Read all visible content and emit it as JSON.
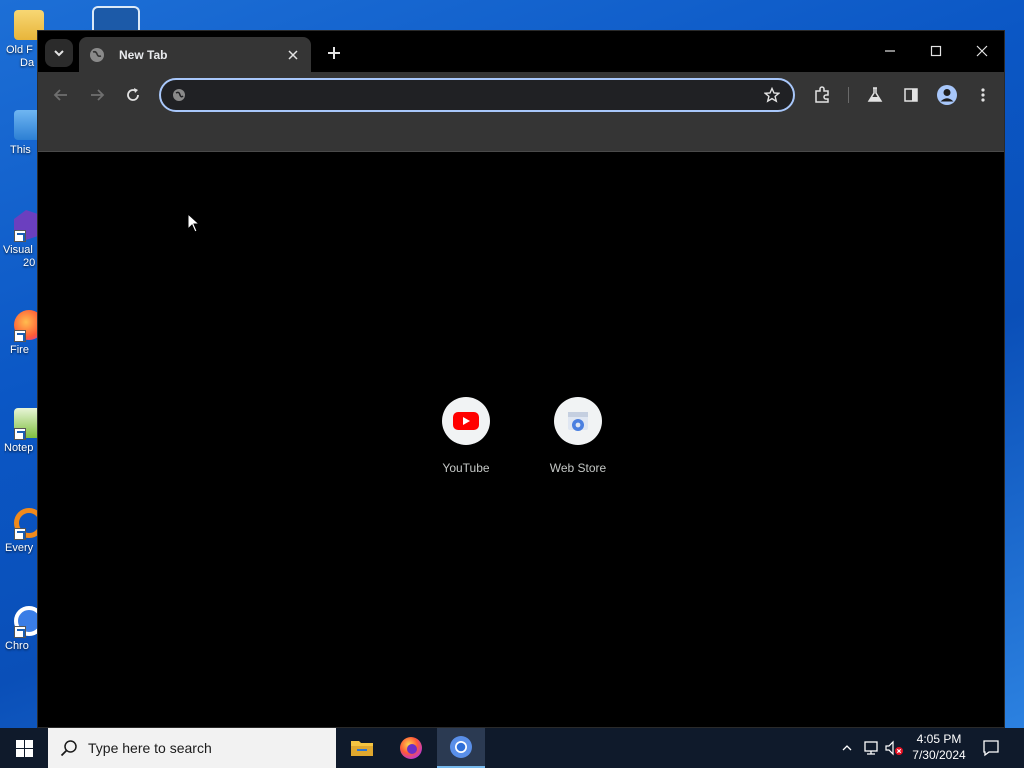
{
  "desktop": {
    "icons": [
      {
        "label": "Old F\nDa",
        "line1": "Old F",
        "line2": "Da"
      },
      {
        "line1": "This",
        "line2": ""
      },
      {
        "line1": "Visual",
        "line2": "20"
      },
      {
        "line1": "Fire",
        "line2": ""
      },
      {
        "line1": "Notep",
        "line2": ""
      },
      {
        "line1": "Every",
        "line2": ""
      },
      {
        "line1": "Chro",
        "line2": ""
      }
    ]
  },
  "browser": {
    "tab": {
      "title": "New Tab"
    },
    "omnibox": {
      "value": "",
      "placeholder": ""
    },
    "shortcuts": [
      {
        "name": "YouTube",
        "icon": "youtube-icon"
      },
      {
        "name": "Web Store",
        "icon": "web-store-icon"
      }
    ]
  },
  "taskbar": {
    "search_placeholder": "Type here to search",
    "time": "4:05 PM",
    "date": "7/30/2024"
  },
  "colors": {
    "toolbar": "#353535",
    "omnibox_border": "#a8c7fa",
    "youtube_red": "#ff0000",
    "accent": "#76b9ed"
  }
}
